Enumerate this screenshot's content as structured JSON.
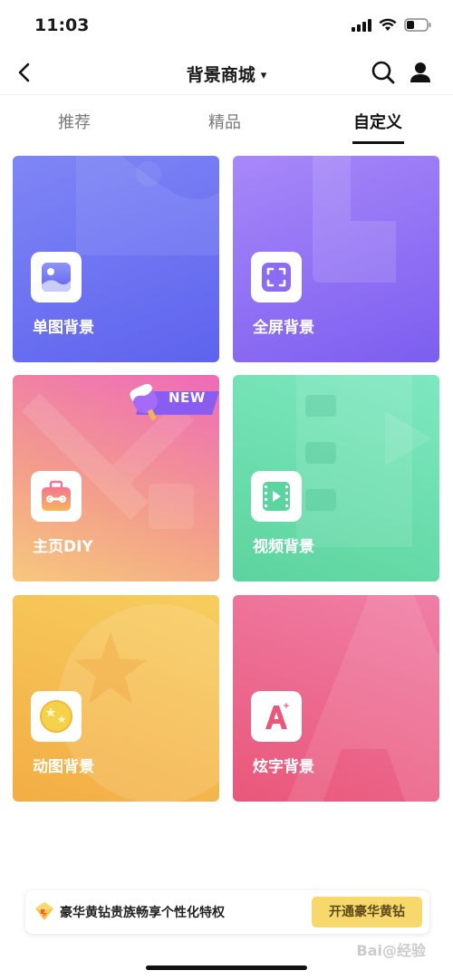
{
  "status_bar": {
    "time": "11:03"
  },
  "nav": {
    "title": "背景商城",
    "caret": "▾"
  },
  "tabs": [
    {
      "label": "推荐",
      "active": false
    },
    {
      "label": "精品",
      "active": false
    },
    {
      "label": "自定义",
      "active": true
    }
  ],
  "cards": [
    {
      "label": "单图背景",
      "icon": "image-icon"
    },
    {
      "label": "全屏背景",
      "icon": "fullscreen-icon"
    },
    {
      "label": "主页DIY",
      "icon": "toolbox-icon",
      "badge": "NEW"
    },
    {
      "label": "视频背景",
      "icon": "video-icon"
    },
    {
      "label": "动图背景",
      "icon": "star-ball-icon"
    },
    {
      "label": "炫字背景",
      "icon": "letter-a-icon"
    }
  ],
  "promo": {
    "text": "豪华黄钻贵族畅享个性化特权",
    "button": "开通豪华黄钻"
  },
  "watermark": "Bai@经验",
  "colors": {
    "accent_yellow": "#f6d86c",
    "card_single": "#6d72f1",
    "card_fullscreen": "#8f70f3",
    "card_diy": "#ef86a5",
    "card_video": "#6cdeaf",
    "card_gif": "#f5bd52",
    "card_text": "#ec6a8f"
  }
}
